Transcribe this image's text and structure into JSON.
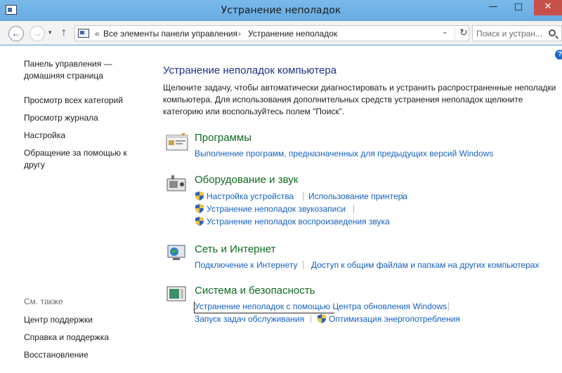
{
  "window": {
    "title": "Устранение неполадок",
    "minimize": "—",
    "maximize": "□",
    "close": "✕"
  },
  "address_bar": {
    "back": "←",
    "forward": "→",
    "recent": "▾",
    "up": "↑",
    "crumb_sep_first": "«",
    "breadcrumb": [
      "Все элементы панели управления",
      "Устранение неполадок"
    ],
    "crumb_sep": "›",
    "dropdown": "⌄",
    "refresh": "↻",
    "search_placeholder": "Поиск и устран..."
  },
  "help": "?",
  "sidebar": {
    "home_line1": "Панель управления —",
    "home_line2": "домашняя страница",
    "items": [
      "Просмотр всех категорий",
      "Просмотр журнала",
      "Настройка"
    ],
    "remote_line1": "Обращение за помощью к",
    "remote_line2": "другу",
    "see_also_title": "См. также",
    "see_also": [
      "Центр поддержки",
      "Справка и поддержка",
      "Восстановление"
    ]
  },
  "main": {
    "title": "Устранение неполадок компьютера",
    "intro": "Щелкните задачу, чтобы автоматически диагностировать и устранить распространенные неполадки компьютера. Для использования дополнительных средств устранения неполадок щелкните категорию или воспользуйтесь полем \"Поиск\".",
    "categories": [
      {
        "icon": "programs-icon",
        "title": "Программы",
        "links": [
          "Выполнение программ, предназначенных для предыдущих версий Windows"
        ]
      },
      {
        "icon": "hardware-sound-icon",
        "title": "Оборудование и звук",
        "links": [
          "Настройка устройства",
          "Использование принтера",
          "Устранение неполадок звукозаписи",
          "Устранение неполадок воспроизведения звука"
        ]
      },
      {
        "icon": "network-icon",
        "title": "Сеть и Интернет",
        "links": [
          "Подключение к Интернету",
          "Доступ к общим файлам и папкам на других компьютерах"
        ]
      },
      {
        "icon": "system-security-icon",
        "title": "Система и безопасность",
        "links": [
          "Устранение неполадок с помощью Центра обновления Windows",
          "Запуск задач обслуживания",
          "Оптимизация энергопотребления"
        ]
      }
    ]
  },
  "colors": {
    "title_bar": "#6fb2e6",
    "close_button": "#c7504a",
    "heading_blue": "#1e3287",
    "category_green": "#0e6b20",
    "link_blue": "#1560c2"
  }
}
